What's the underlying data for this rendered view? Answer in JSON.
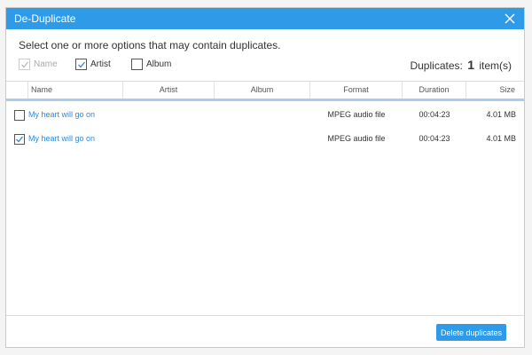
{
  "window": {
    "title": "De-Duplicate",
    "accent": "#2f9ae8"
  },
  "prompt": "Select one or more options that may contain duplicates.",
  "options": [
    {
      "label": "Name",
      "checked": true,
      "disabled": true
    },
    {
      "label": "Artist",
      "checked": true,
      "disabled": false
    },
    {
      "label": "Album",
      "checked": false,
      "disabled": false
    }
  ],
  "duplicates": {
    "prefix": "Duplicates:",
    "count": "1",
    "suffix": "item(s)"
  },
  "table": {
    "headers": [
      "Name",
      "Artist",
      "Album",
      "Format",
      "Duration",
      "Size"
    ],
    "rows": [
      {
        "checked": false,
        "name": "My heart will go on",
        "artist": "",
        "album": "",
        "format": "MPEG audio file",
        "duration": "00:04:23",
        "size": "4.01 MB"
      },
      {
        "checked": true,
        "name": "My heart will go on",
        "artist": "",
        "album": "",
        "format": "MPEG audio file",
        "duration": "00:04:23",
        "size": "4.01 MB"
      }
    ]
  },
  "actions": {
    "delete_label": "Delete duplicates"
  }
}
